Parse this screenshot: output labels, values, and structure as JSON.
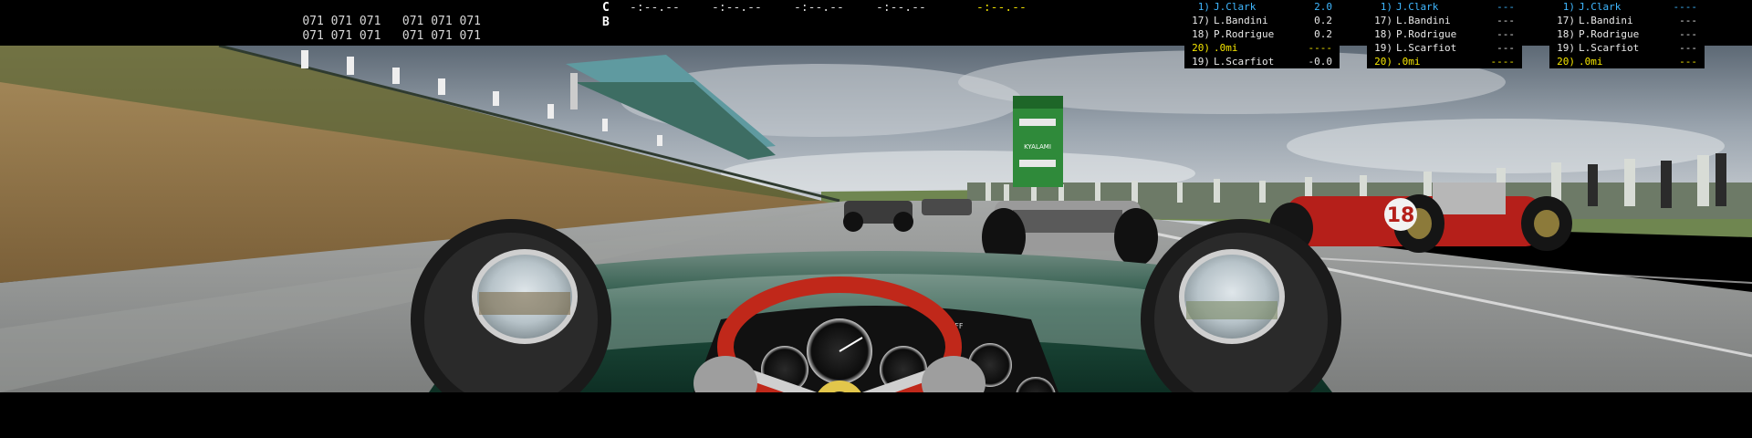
{
  "hud": {
    "tyre_temps_row1": [
      "071 071 071",
      "071 071 071"
    ],
    "tyre_temps_row2": [
      "071 071 071",
      "071 071 071"
    ],
    "lap_label_c": "C",
    "lap_label_b": "B",
    "lap_times": [
      "-:--.--",
      "-:--.--",
      "-:--.--",
      "-:--.--",
      "-:--.--"
    ],
    "lap_time_highlight_color": "#e6d800"
  },
  "standings": [
    {
      "rows": [
        {
          "pos": "1)",
          "name": "J.Clark",
          "gap": "2.0",
          "style": "blue"
        },
        {
          "pos": "17)",
          "name": "L.Bandini",
          "gap": "0.2",
          "style": "white"
        },
        {
          "pos": "18)",
          "name": "P.Rodrigue",
          "gap": "0.2",
          "style": "white"
        },
        {
          "pos": "20)",
          "name": ".0mi",
          "gap": "----",
          "style": "yellow"
        },
        {
          "pos": "19)",
          "name": "L.Scarfiot",
          "gap": "-0.0",
          "style": "white"
        }
      ]
    },
    {
      "rows": [
        {
          "pos": "1)",
          "name": "J.Clark",
          "gap": "---",
          "style": "blue"
        },
        {
          "pos": "17)",
          "name": "L.Bandini",
          "gap": "---",
          "style": "white"
        },
        {
          "pos": "18)",
          "name": "P.Rodrigue",
          "gap": "---",
          "style": "white"
        },
        {
          "pos": "19)",
          "name": "L.Scarfiot",
          "gap": "---",
          "style": "white"
        },
        {
          "pos": "20)",
          "name": ".0mi",
          "gap": "----",
          "style": "yellow"
        }
      ]
    },
    {
      "rows": [
        {
          "pos": "1)",
          "name": "J.Clark",
          "gap": "----",
          "style": "blue"
        },
        {
          "pos": "17)",
          "name": "L.Bandini",
          "gap": "---",
          "style": "white"
        },
        {
          "pos": "18)",
          "name": "P.Rodrigue",
          "gap": "---",
          "style": "white"
        },
        {
          "pos": "19)",
          "name": "L.Scarfiot",
          "gap": "---",
          "style": "white"
        },
        {
          "pos": "20)",
          "name": ".0mi",
          "gap": "---",
          "style": "yellow"
        }
      ]
    }
  ],
  "scene": {
    "opponent_car_number": "18",
    "tower_sign": "KYALAMI",
    "dash_off_label": "OFF",
    "colors": {
      "sky_top": "#6f7a86",
      "sky_mid": "#bfc6cd",
      "track": "#8c8e8d",
      "bank": "#9a7d52",
      "grass": "#6f8650",
      "car_green": "#145a3e",
      "wheel_red": "#c0281a",
      "ferrari_red": "#b51f1a",
      "tower_green": "#2f8a3a"
    }
  }
}
